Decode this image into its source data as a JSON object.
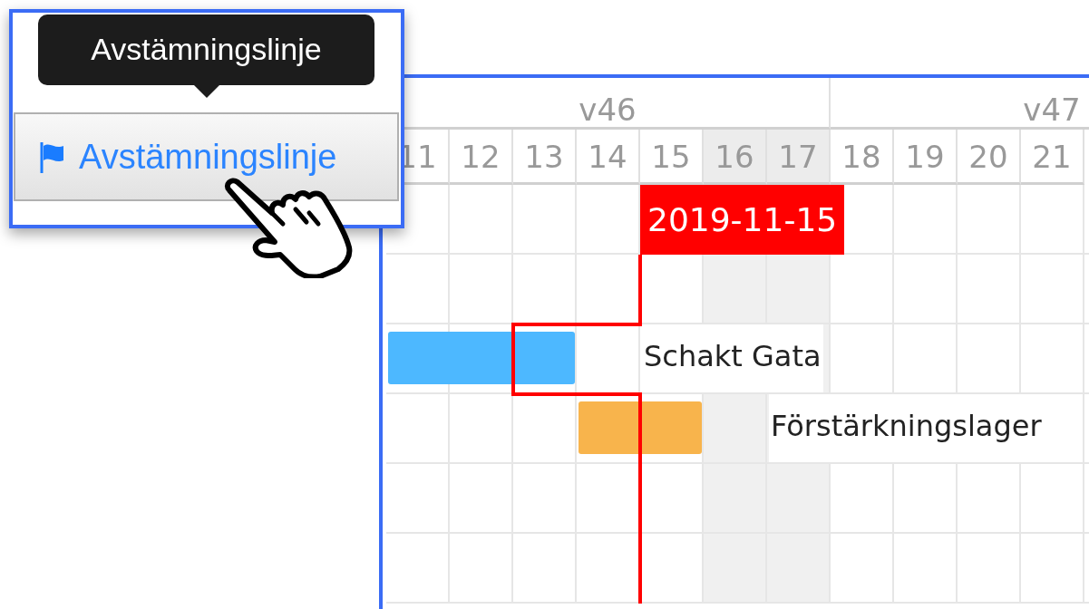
{
  "popup": {
    "tooltip": "Avstämningslinje",
    "button": {
      "label": "Avstämningslinje"
    }
  },
  "gantt": {
    "weeks": [
      {
        "label": "v46"
      },
      {
        "label": "v47"
      }
    ],
    "days": [
      {
        "label": "11",
        "weekend": false
      },
      {
        "label": "12",
        "weekend": false
      },
      {
        "label": "13",
        "weekend": false
      },
      {
        "label": "14",
        "weekend": false
      },
      {
        "label": "15",
        "weekend": false
      },
      {
        "label": "16",
        "weekend": true
      },
      {
        "label": "17",
        "weekend": true
      },
      {
        "label": "18",
        "weekend": false
      },
      {
        "label": "19",
        "weekend": false
      },
      {
        "label": "20",
        "weekend": false
      },
      {
        "label": "21",
        "weekend": false
      }
    ],
    "rows": [
      {
        "kind": "marker",
        "label": "2019-11-15"
      },
      {
        "kind": "empty"
      },
      {
        "kind": "task",
        "name": "Schakt Gata",
        "color": "#4db8ff"
      },
      {
        "kind": "task",
        "name": "Förstärkningslager",
        "color": "#f8b44c"
      },
      {
        "kind": "empty"
      },
      {
        "kind": "empty"
      }
    ]
  }
}
